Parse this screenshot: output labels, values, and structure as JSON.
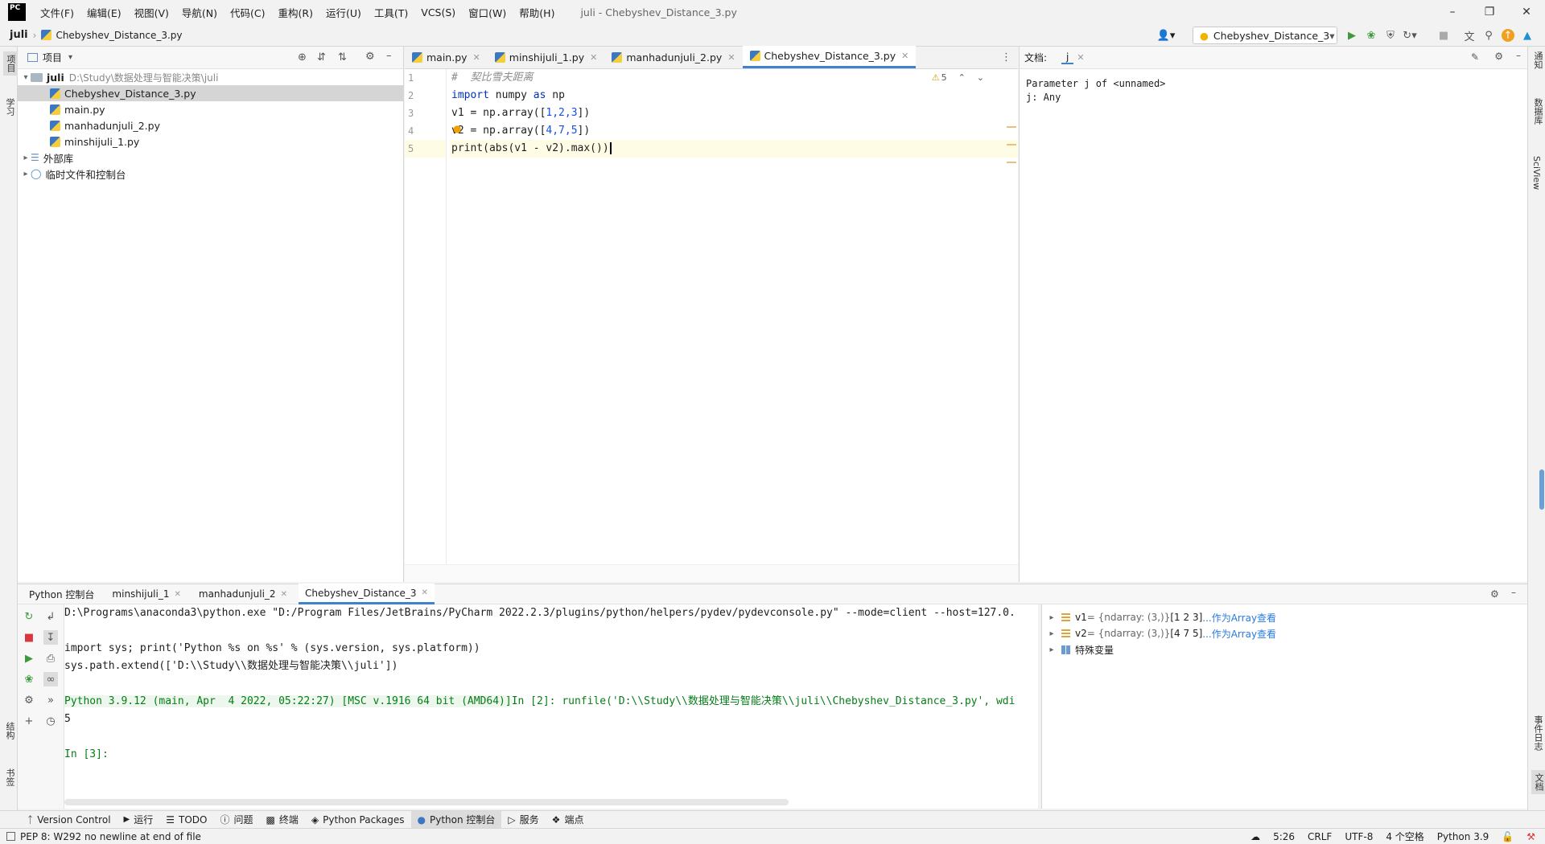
{
  "menubar": {
    "logo": "PC",
    "items": [
      "文件(F)",
      "编辑(E)",
      "视图(V)",
      "导航(N)",
      "代码(C)",
      "重构(R)",
      "运行(U)",
      "工具(T)",
      "VCS(S)",
      "窗口(W)",
      "帮助(H)"
    ],
    "window_title": "juli - Chebyshev_Distance_3.py"
  },
  "navbar": {
    "root": "juli",
    "file": "Chebyshev_Distance_3.py",
    "run_config": "Chebyshev_Distance_3"
  },
  "left_stripe": {
    "project": "项目",
    "learn": "学习",
    "structure": "结构",
    "bookmarks": "书签"
  },
  "right_stripe": {
    "notifications": "通知",
    "database": "数据库",
    "sciview": "SciView",
    "event_log": "事件日志",
    "docs": "文档"
  },
  "project": {
    "title": "项目",
    "root_name": "juli",
    "root_path": "D:\\Study\\数据处理与智能决策\\juli",
    "files": [
      "Chebyshev_Distance_3.py",
      "main.py",
      "manhadunjuli_2.py",
      "minshijuli_1.py"
    ],
    "external_libs": "外部库",
    "scratches": "临时文件和控制台"
  },
  "editor": {
    "tabs": [
      "main.py",
      "minshijuli_1.py",
      "manhadunjuli_2.py",
      "Chebyshev_Distance_3.py"
    ],
    "warning_count": "5",
    "line_numbers": [
      "1",
      "2",
      "3",
      "4",
      "5"
    ],
    "lines": {
      "l1": "#  契比雪夫距离",
      "l2_kw1": "import",
      "l2_mod": " numpy ",
      "l2_kw2": "as",
      "l2_alias": " np",
      "l3_pre": "v1 = np.array([",
      "l3_nums": "1,2,3",
      "l3_post": "])",
      "l4_pre": "v2 = np.array([",
      "l4_nums": "4,7,5",
      "l4_post": "])",
      "l5": "print(abs(v1 - v2).max())"
    }
  },
  "doc": {
    "label": "文档:",
    "tab": "j",
    "line1": "Parameter j of <unnamed>",
    "line2": "j: Any"
  },
  "console": {
    "tabs": [
      "Python 控制台",
      "minshijuli_1",
      "manhadunjuli_2",
      "Chebyshev_Distance_3"
    ],
    "lines": {
      "c1": "D:\\Programs\\anaconda3\\python.exe \"D:/Program Files/JetBrains/PyCharm 2022.2.3/plugins/python/helpers/pydev/pydevconsole.py\" --mode=client --host=127.0.",
      "c3": "import sys; print('Python %s on %s' % (sys.version, sys.platform))",
      "c4": "sys.path.extend(['D:\\\\Study\\\\数据处理与智能决策\\\\juli'])",
      "c6a": "Python 3.9.12 (main, Apr  4 2022, 05:22:27) [MSC v.1916 64 bit (AMD64)]",
      "c6b": "In [2]: runfile('D:\\\\Study\\\\数据处理与智能决策\\\\juli\\\\Chebyshev_Distance_3.py', wdi",
      "c7": "5",
      "c9": "In [3]:"
    }
  },
  "variables": [
    {
      "name": "v1",
      "type": " = {ndarray: (3,)} ",
      "value": "[1 2 3]",
      "link": "...作为Array查看"
    },
    {
      "name": "v2",
      "type": " = {ndarray: (3,)} ",
      "value": "[4 7 5]",
      "link": "...作为Array查看"
    },
    {
      "name": "特殊变量",
      "type": "",
      "value": "",
      "link": ""
    }
  ],
  "bottom_tools": [
    "Version Control",
    "运行",
    "TODO",
    "问题",
    "终端",
    "Python Packages",
    "Python 控制台",
    "服务",
    "端点"
  ],
  "status": {
    "message": "PEP 8: W292 no newline at end of file",
    "position": "5:26",
    "line_sep": "CRLF",
    "encoding": "UTF-8",
    "indent": "4 个空格",
    "interpreter": "Python 3.9"
  }
}
